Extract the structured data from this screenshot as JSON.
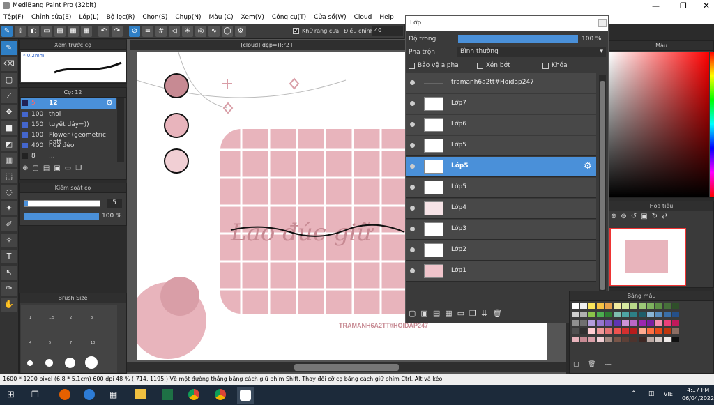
{
  "app": {
    "title": "MediBang Paint Pro (32bit)"
  },
  "menu": [
    "Tệp(F)",
    "Chỉnh sửa(E)",
    "Lớp(L)",
    "Bộ lọc(R)",
    "Chọn(S)",
    "Chụp(N)",
    "Màu (C)",
    "Xem(V)",
    "Công cụ(T)",
    "Cửa sổ(W)",
    "Cloud",
    "Help"
  ],
  "toolbar": {
    "antialias": "Khử răng cưa",
    "correction_label": "Điều chỉnh",
    "correction_value": "40"
  },
  "brush_preview": {
    "title": "Xem trước cọ",
    "size": "* 0.2mm"
  },
  "brush_list": {
    "title": "Cọ: 12",
    "items": [
      {
        "size": "5",
        "name": "12"
      },
      {
        "size": "100",
        "name": "thoi"
      },
      {
        "size": "150",
        "name": "tuyết dây=))"
      },
      {
        "size": "100",
        "name": "Flower (geometric patt"
      },
      {
        "size": "400",
        "name": "hoa đèo"
      },
      {
        "size": "8",
        "name": "..."
      }
    ]
  },
  "brush_control": {
    "title": "Kiểm soát cọ",
    "size": "5",
    "opacity": "100 %",
    "opacity_value": 1.0
  },
  "brush_size": {
    "title": "Brush Size",
    "labels": [
      "1",
      "1.5",
      "2",
      "3",
      "4",
      "5",
      "7",
      "10"
    ]
  },
  "document": {
    "tab": "[cloud] đẹp=)):r2+",
    "script_text": "Lao đúc giữ",
    "watermark": "TRAMANH6A2TT#HOIDAP247"
  },
  "layer_panel": {
    "title": "Lớp",
    "opacity_label": "Độ trong",
    "opacity_value": "100 %",
    "opacity_fraction": 1.0,
    "blend_label": "Pha trộn",
    "blend_value": "Bình thường",
    "protect_alpha": "Bảo vệ alpha",
    "clip": "Xén bớt",
    "lock": "Khóa",
    "layers": [
      "tramanh6a2tt#Hoidap247",
      "Lớp7",
      "Lớp6",
      "Lớp5",
      "Lớp5",
      "Lớp5",
      "Lớp4",
      "Lớp3",
      "Lớp2",
      "Lớp1"
    ],
    "selected_index": 4
  },
  "color_panel": {
    "title": "Màu"
  },
  "navigator": {
    "title": "Hoa tiêu"
  },
  "palette": {
    "title": "Bảng màu",
    "footer": "---"
  },
  "status": {
    "text": "1600 * 1200 pixel   (6,8 * 5.1cm)  600 dpi   48 %   ( 714, 1195 )  Vẽ một đường thẳng bằng cách giữ phím Shift, Thay đổi cỡ cọ bằng cách giữ phím Ctrl, Alt và kéo"
  },
  "taskbar": {
    "lang": "VIE",
    "time": "4:17 PM",
    "date": "06/04/2022"
  },
  "colors": {
    "accent": "#4a90d9",
    "pink": "#e8b4bc",
    "dark_pink": "#c78a93"
  }
}
